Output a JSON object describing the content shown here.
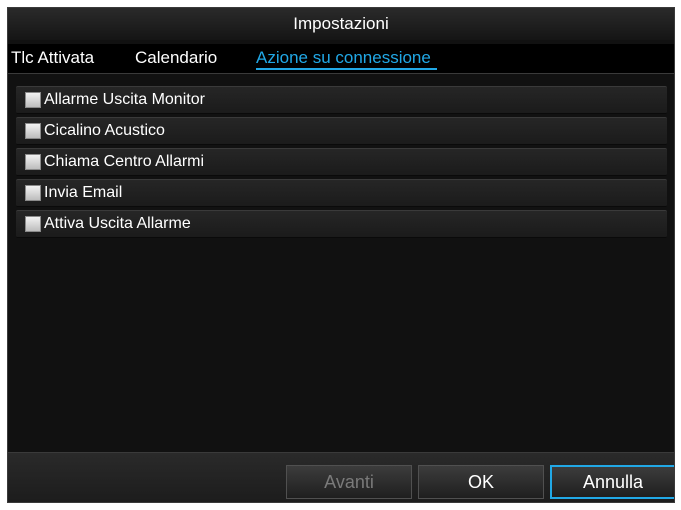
{
  "dialog": {
    "title": "Impostazioni"
  },
  "tabs": [
    {
      "label": "Tlc Attivata",
      "active": false
    },
    {
      "label": "Calendario",
      "active": false
    },
    {
      "label": "Azione su connessione",
      "active": true
    }
  ],
  "actions": [
    {
      "label": "Allarme Uscita Monitor",
      "checked": false
    },
    {
      "label": "Cicalino Acustico",
      "checked": false
    },
    {
      "label": "Chiama Centro Allarmi",
      "checked": false
    },
    {
      "label": "Invia Email",
      "checked": false
    },
    {
      "label": "Attiva Uscita Allarme",
      "checked": false
    }
  ],
  "footer": {
    "next_label": "Avanti",
    "ok_label": "OK",
    "cancel_label": "Annulla"
  },
  "colors": {
    "accent": "#21a8e6",
    "background": "#111111"
  }
}
